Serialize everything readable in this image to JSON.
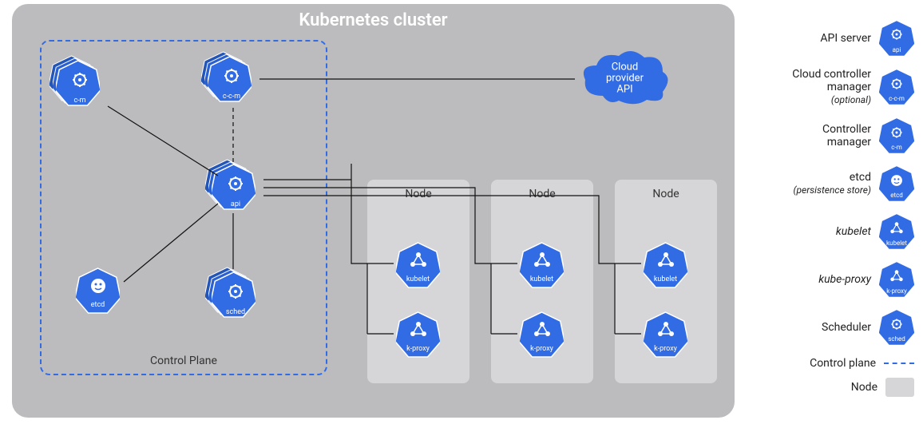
{
  "cluster": {
    "title": "Kubernetes cluster",
    "control_plane_label": "Control Plane",
    "components": {
      "cm": {
        "label": "c-m"
      },
      "ccm": {
        "label": "c-c-m"
      },
      "api": {
        "label": "api"
      },
      "etcd": {
        "label": "etcd"
      },
      "sched": {
        "label": "sched"
      }
    },
    "cloud": {
      "line1": "Cloud",
      "line2": "provider",
      "line3": "API"
    },
    "nodes": [
      {
        "label": "Node",
        "kubelet": "kubelet",
        "kproxy": "k-proxy"
      },
      {
        "label": "Node",
        "kubelet": "kubelet",
        "kproxy": "k-proxy"
      },
      {
        "label": "Node",
        "kubelet": "kubelet",
        "kproxy": "k-proxy"
      }
    ]
  },
  "legend": {
    "api": {
      "text": "API server",
      "icon_label": "api"
    },
    "ccm": {
      "text1": "Cloud controller",
      "text2": "manager",
      "sub": "(optional)",
      "icon_label": "c-c-m"
    },
    "cm": {
      "text1": "Controller",
      "text2": "manager",
      "icon_label": "c-m"
    },
    "etcd": {
      "text1": "etcd",
      "sub": "(persistence store)",
      "icon_label": "etcd"
    },
    "kubelet": {
      "text": "kubelet",
      "icon_label": "kubelet"
    },
    "kproxy": {
      "text": "kube-proxy",
      "icon_label": "k-proxy"
    },
    "sched": {
      "text": "Scheduler",
      "icon_label": "sched"
    },
    "control_plane": "Control plane",
    "node": "Node"
  },
  "colors": {
    "k8s_blue": "#326ce5",
    "bg_gray": "#bcbcbe",
    "node_gray": "#d6d6d8"
  }
}
